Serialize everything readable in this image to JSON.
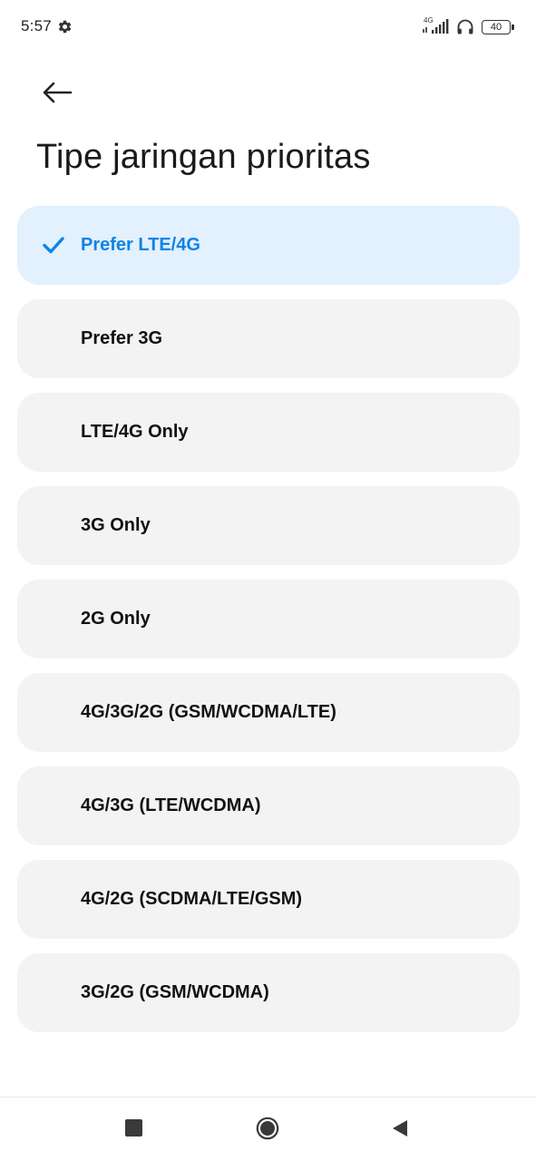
{
  "status_bar": {
    "time": "5:57",
    "network_type": "4G",
    "battery_level": "40",
    "icons": [
      "gear-icon",
      "signal-icon",
      "headphones-icon",
      "battery-icon"
    ]
  },
  "header": {
    "back_icon": "arrow-left-icon",
    "title": "Tipe jaringan prioritas"
  },
  "options": [
    {
      "label": "Prefer LTE/4G",
      "selected": true
    },
    {
      "label": "Prefer 3G",
      "selected": false
    },
    {
      "label": "LTE/4G Only",
      "selected": false
    },
    {
      "label": "3G Only",
      "selected": false
    },
    {
      "label": "2G Only",
      "selected": false
    },
    {
      "label": "4G/3G/2G (GSM/WCDMA/LTE)",
      "selected": false
    },
    {
      "label": "4G/3G (LTE/WCDMA)",
      "selected": false
    },
    {
      "label": "4G/2G (SCDMA/LTE/GSM)",
      "selected": false
    },
    {
      "label": "3G/2G (GSM/WCDMA)",
      "selected": false
    }
  ],
  "nav_bar": {
    "icons": [
      "recents-square-icon",
      "home-circle-icon",
      "back-triangle-icon"
    ]
  },
  "colors": {
    "accent": "#0d84e6",
    "selected_background": "#e3f0fd",
    "option_background": "#f3f3f3",
    "text": "#111111"
  }
}
